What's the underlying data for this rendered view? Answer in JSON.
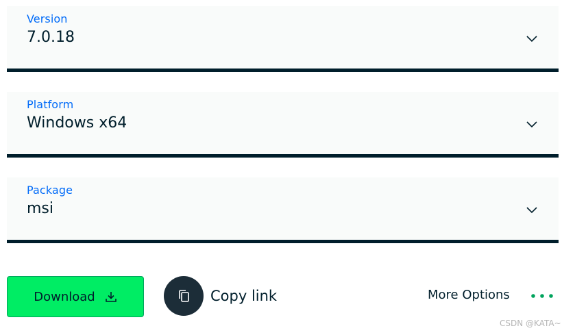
{
  "selects": {
    "version": {
      "label": "Version",
      "value": "7.0.18"
    },
    "platform": {
      "label": "Platform",
      "value": "Windows x64"
    },
    "package": {
      "label": "Package",
      "value": "msi"
    }
  },
  "actions": {
    "download_label": "Download",
    "copy_link_label": "Copy link",
    "more_options_label": "More Options"
  },
  "watermark": "CSDN @KATA~",
  "icons": {
    "chevron": "chevron-down-icon",
    "download": "download-icon",
    "copy": "copy-icon",
    "more": "more-dots-icon"
  },
  "colors": {
    "accent_label": "#016bf8",
    "primary_button": "#00ed64",
    "dark": "#001e2b",
    "dots": "#00a35c"
  }
}
